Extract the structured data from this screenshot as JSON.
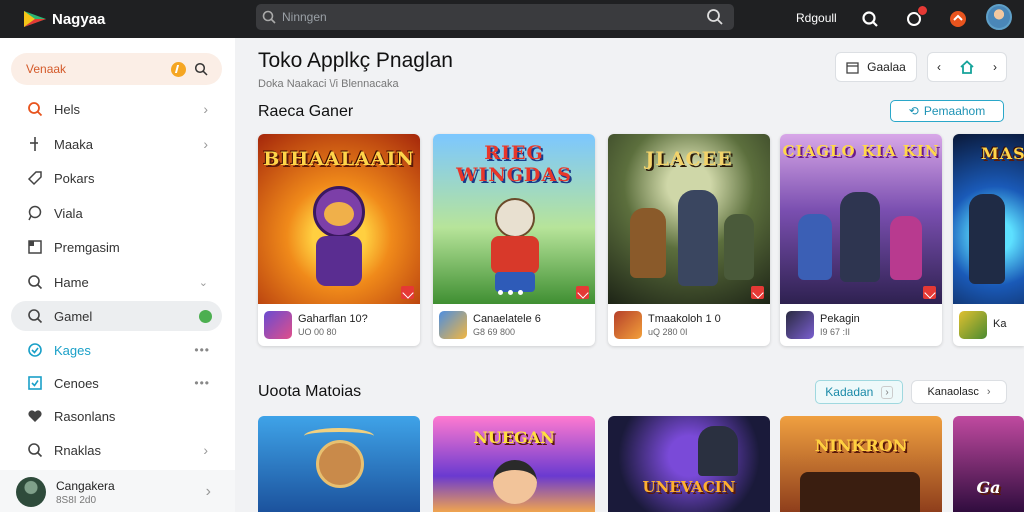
{
  "app": {
    "name": "Nagyaa"
  },
  "topbar": {
    "search_placeholder": "Ninngen",
    "user_label": "Rdgoull"
  },
  "sidebar": {
    "search_label": "Venaak",
    "items": [
      {
        "label": "Hels",
        "icon": "search-icon"
      },
      {
        "label": "Maaka",
        "icon": "pin-icon"
      },
      {
        "label": "Pokars",
        "icon": "tag-icon"
      },
      {
        "label": "Viala",
        "icon": "chat-icon"
      },
      {
        "label": "Premgasim",
        "icon": "image-icon"
      },
      {
        "label": "Hame",
        "icon": "search-icon"
      },
      {
        "label": "Gamel",
        "icon": "search-icon"
      },
      {
        "label": "Kages",
        "icon": "shield-icon"
      },
      {
        "label": "Cenoes",
        "icon": "check-icon"
      },
      {
        "label": "Rasonlans",
        "icon": "heart-icon"
      },
      {
        "label": "Rnaklas",
        "icon": "search-icon"
      }
    ],
    "profile": {
      "name": "Cangakera",
      "sub": "8S8I 2d0"
    }
  },
  "main": {
    "title": "Toko Applkç Pnaglan",
    "subtitle": "Doka Naakaci \\/i Blennacaka",
    "toolbar": {
      "grid_label": "Gaalaa"
    },
    "section1": {
      "title": "Raeca Ganer",
      "button": "Pemaahom",
      "cards": [
        {
          "art_title": "BIHAALAAIN",
          "name": "Gaharflan 10?",
          "meta": "UO 00 80"
        },
        {
          "art_title": "RIEG WINGDAS",
          "name": "Canaelatele 6",
          "meta": "G8 69 800"
        },
        {
          "art_title": "JLACEE",
          "name": "Tmaakoloh 1 0",
          "meta": "uQ 280 0I"
        },
        {
          "art_title": "CIAGLO KIA KIN",
          "name": "Pekagin",
          "meta": "I9 67 :II"
        },
        {
          "art_title": "MAS",
          "name": "Ka",
          "meta": ""
        }
      ]
    },
    "section2": {
      "title": "Uoota Matoias",
      "btn_primary": "Kadadan",
      "btn_secondary": "Kanaolasc",
      "cards": [
        {
          "art_title": ""
        },
        {
          "art_title": "NUEGAN"
        },
        {
          "art_title": "UNEVACIN"
        },
        {
          "art_title": "NINKRON"
        },
        {
          "art_title": "Ga"
        }
      ]
    }
  }
}
